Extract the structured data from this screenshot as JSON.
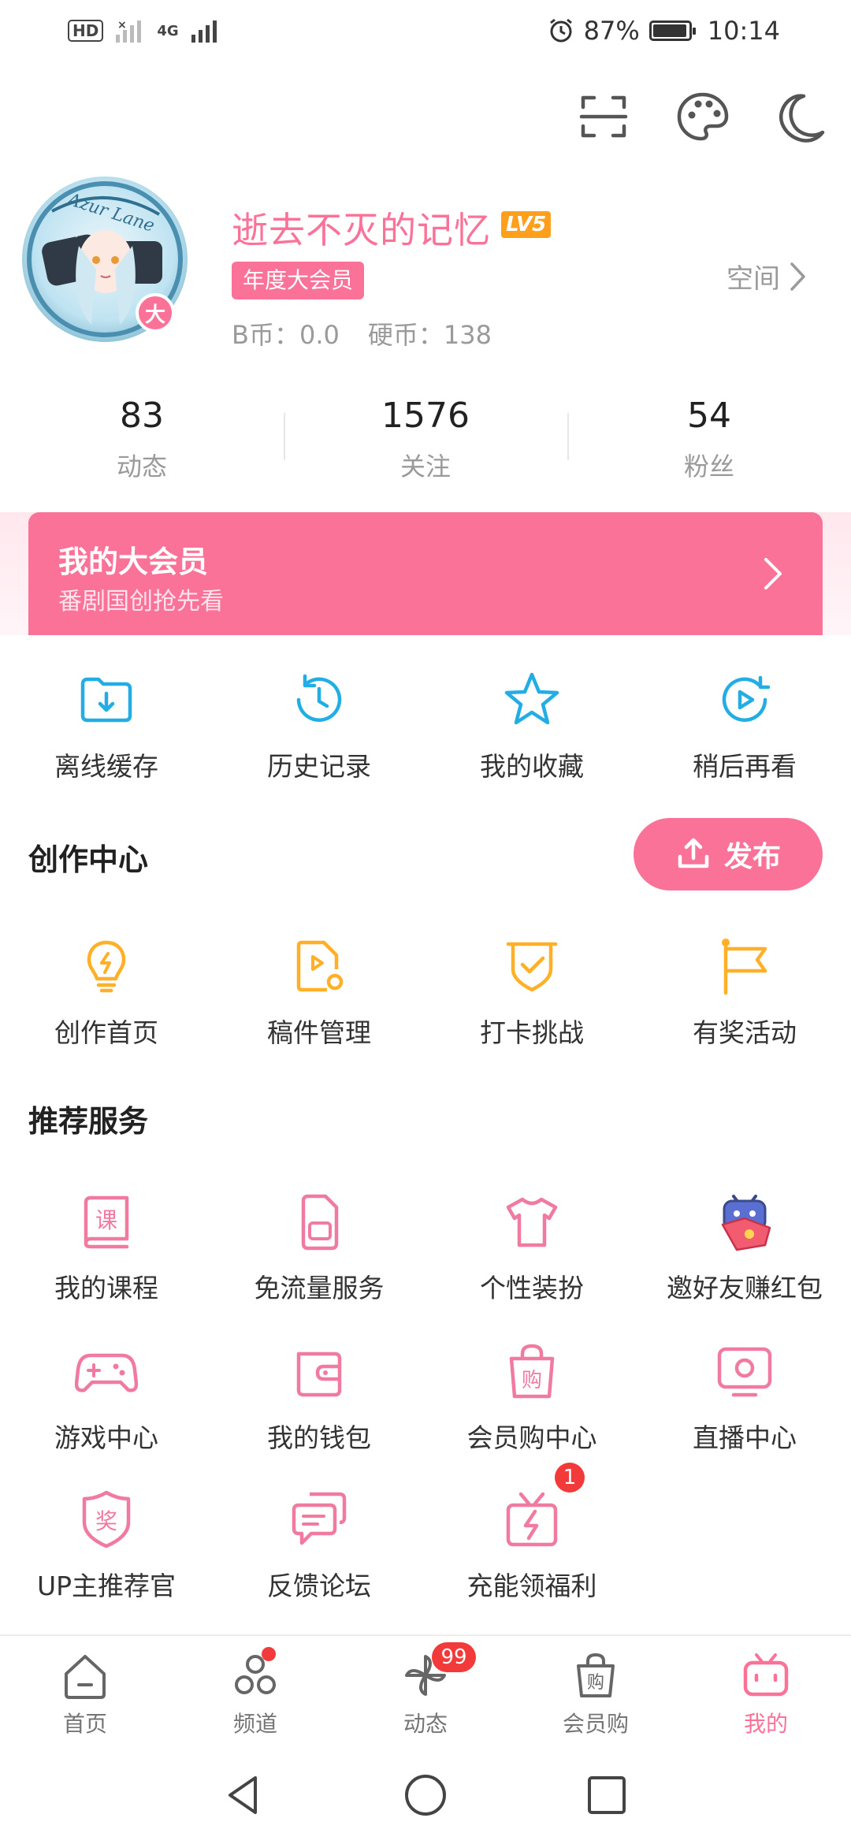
{
  "status_bar": {
    "hd": "HD",
    "network": "4G",
    "battery": "87%",
    "time": "10:14"
  },
  "profile": {
    "username": "逝去不灭的记忆",
    "level": "LV5",
    "vip_tag": "年度大会员",
    "avatar_badge": "大",
    "b_coin": "B币：0.0",
    "coin": "硬币：138",
    "space_link": "空间"
  },
  "stats": [
    {
      "num": "83",
      "label": "动态"
    },
    {
      "num": "1576",
      "label": "关注"
    },
    {
      "num": "54",
      "label": "粉丝"
    }
  ],
  "vip_banner": {
    "title": "我的大会员",
    "subtitle": "番剧国创抢先看"
  },
  "quick_actions": [
    {
      "label": "离线缓存",
      "icon": "download-folder-icon"
    },
    {
      "label": "历史记录",
      "icon": "history-clock-icon"
    },
    {
      "label": "我的收藏",
      "icon": "star-icon"
    },
    {
      "label": "稍后再看",
      "icon": "watch-later-icon"
    }
  ],
  "creation": {
    "title": "创作中心",
    "publish_label": "发布",
    "items": [
      {
        "label": "创作首页",
        "icon": "lightbulb-icon"
      },
      {
        "label": "稿件管理",
        "icon": "manuscript-icon"
      },
      {
        "label": "打卡挑战",
        "icon": "checkin-shield-icon"
      },
      {
        "label": "有奖活动",
        "icon": "flag-icon"
      }
    ]
  },
  "services": {
    "title": "推荐服务",
    "items": [
      {
        "label": "我的课程",
        "icon": "course-book-icon",
        "glyph": "课"
      },
      {
        "label": "免流量服务",
        "icon": "sim-card-icon"
      },
      {
        "label": "个性装扮",
        "icon": "tshirt-icon"
      },
      {
        "label": "邀好友赚红包",
        "icon": "tv-mascot-envelope-icon"
      },
      {
        "label": "游戏中心",
        "icon": "gamepad-icon"
      },
      {
        "label": "我的钱包",
        "icon": "wallet-icon"
      },
      {
        "label": "会员购中心",
        "icon": "shopping-bag-icon",
        "glyph": "购"
      },
      {
        "label": "直播中心",
        "icon": "live-tv-icon"
      },
      {
        "label": "UP主推荐官",
        "icon": "award-shield-icon",
        "glyph": "奖"
      },
      {
        "label": "反馈论坛",
        "icon": "feedback-chat-icon"
      },
      {
        "label": "充能领福利",
        "icon": "gift-lightning-icon",
        "badge": "1"
      }
    ]
  },
  "bottom_nav": [
    {
      "label": "首页",
      "icon": "home-icon"
    },
    {
      "label": "频道",
      "icon": "channel-icon"
    },
    {
      "label": "动态",
      "icon": "pinwheel-icon",
      "badge": "99"
    },
    {
      "label": "会员购",
      "icon": "shopping-bag-icon",
      "glyph": "购"
    },
    {
      "label": "我的",
      "icon": "tv-mine-icon"
    }
  ],
  "colors": {
    "accent": "#fb7299",
    "blue_icon": "#23ade5",
    "orange_icon": "#ffb027",
    "text_secondary": "#9a9a9a"
  }
}
